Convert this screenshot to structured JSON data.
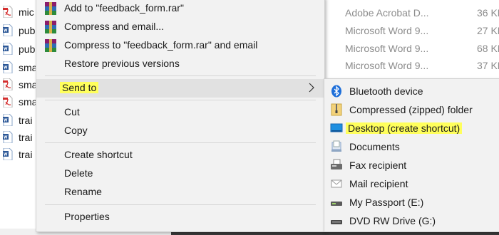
{
  "explorer": {
    "files": [
      {
        "name": "mic",
        "icon": "pdf-file-icon"
      },
      {
        "name": "pub",
        "icon": "word-file-icon"
      },
      {
        "name": "pub",
        "icon": "word-file-icon"
      },
      {
        "name": "sma",
        "icon": "word-file-icon"
      },
      {
        "name": "sma",
        "icon": "pdf-file-icon"
      },
      {
        "name": "sma",
        "icon": "pdf-file-icon"
      },
      {
        "name": "trai",
        "icon": "word-file-icon"
      },
      {
        "name": "trai",
        "icon": "word-file-icon"
      },
      {
        "name": "trai",
        "icon": "word-file-icon"
      }
    ],
    "details": [
      {
        "type": "Adobe Acrobat D...",
        "size": "36 KB"
      },
      {
        "type": "Microsoft Word 9...",
        "size": "27 KB"
      },
      {
        "type": "Microsoft Word 9...",
        "size": "68 KB"
      },
      {
        "type": "Microsoft Word 9...",
        "size": "37 KB"
      }
    ]
  },
  "context_menu": {
    "items": [
      {
        "label": "Add to \"feedback_form.rar\"",
        "icon": "winrar-icon"
      },
      {
        "label": "Compress and email...",
        "icon": "winrar-icon"
      },
      {
        "label": "Compress to \"feedback_form.rar\" and email",
        "icon": "winrar-icon"
      },
      {
        "label": "Restore previous versions"
      },
      {
        "label": "Send to",
        "has_submenu": true,
        "highlighted": true
      },
      {
        "label": "Cut"
      },
      {
        "label": "Copy"
      },
      {
        "label": "Create shortcut"
      },
      {
        "label": "Delete"
      },
      {
        "label": "Rename"
      },
      {
        "label": "Properties"
      }
    ]
  },
  "send_to_menu": {
    "items": [
      {
        "label": "Bluetooth device",
        "icon": "bluetooth-icon"
      },
      {
        "label": "Compressed (zipped) folder",
        "icon": "zip-folder-icon"
      },
      {
        "label": "Desktop (create shortcut)",
        "icon": "desktop-icon",
        "highlighted": true
      },
      {
        "label": "Documents",
        "icon": "documents-icon"
      },
      {
        "label": "Fax recipient",
        "icon": "fax-icon"
      },
      {
        "label": "Mail recipient",
        "icon": "mail-icon"
      },
      {
        "label": "My Passport (E:)",
        "icon": "usb-drive-icon"
      },
      {
        "label": "DVD RW Drive (G:)",
        "icon": "dvd-drive-icon"
      }
    ]
  },
  "colors": {
    "highlight": "#ffff5c",
    "menu_bg": "#f2f2f2",
    "hover_bg": "#e1e1e1",
    "bluetooth": "#1e6fd9"
  }
}
